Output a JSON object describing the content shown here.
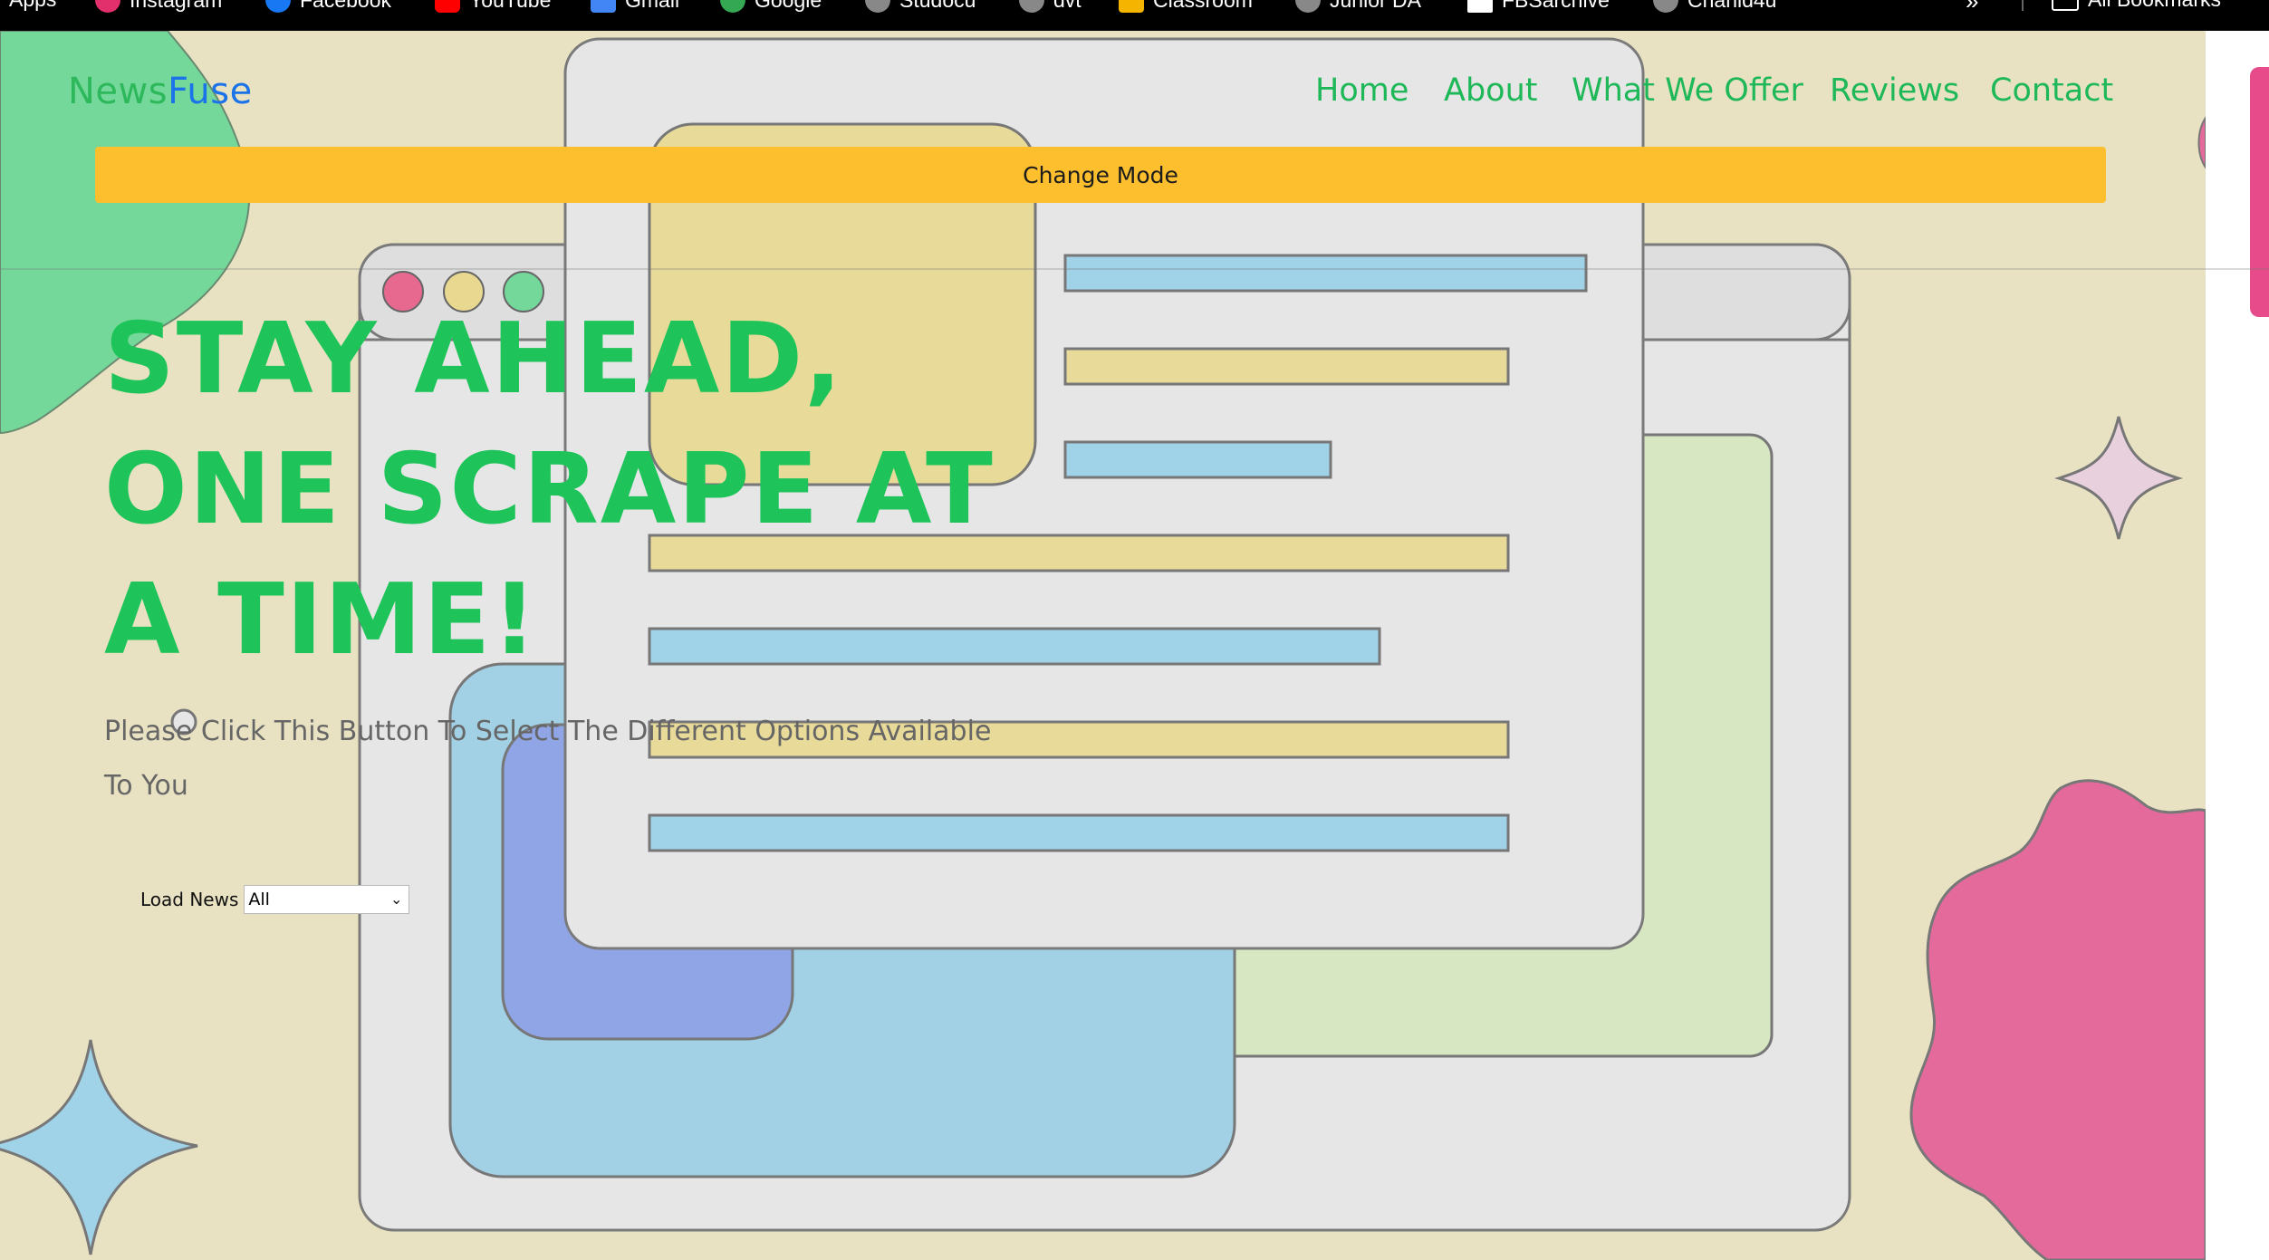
{
  "bookmarks": {
    "items": [
      {
        "label": "Apps",
        "icon": "apps-grid-icon",
        "color": "#ffffff"
      },
      {
        "label": "Instagram",
        "icon": "instagram-icon",
        "color": "#e1306c"
      },
      {
        "label": "Facebook",
        "icon": "facebook-icon",
        "color": "#1877f2"
      },
      {
        "label": "YouTube",
        "icon": "youtube-icon",
        "color": "#ff0000"
      },
      {
        "label": "Gmail",
        "icon": "gmail-icon",
        "color": "#4285f4"
      },
      {
        "label": "Google",
        "icon": "google-icon",
        "color": "#34a853"
      },
      {
        "label": "Studocu",
        "icon": "globe-icon",
        "color": "#888888"
      },
      {
        "label": "dvt",
        "icon": "globe-icon",
        "color": "#888888"
      },
      {
        "label": "Classroom",
        "icon": "classroom-icon",
        "color": "#f4b400"
      },
      {
        "label": "Junior DA",
        "icon": "globe-icon",
        "color": "#888888"
      },
      {
        "label": "FBSarchive",
        "icon": "page-icon",
        "color": "#ffffff"
      },
      {
        "label": "Chahid4u",
        "icon": "globe-icon",
        "color": "#888888"
      }
    ],
    "more": "»",
    "all_bookmarks": "All Bookmarks"
  },
  "site": {
    "logo_part1": "News",
    "logo_part2": "Fuse",
    "logo_colors": [
      "#2eb85c",
      "#1a73e8"
    ],
    "nav": [
      "Home",
      "About",
      "What We Offer",
      "Reviews",
      "Contact"
    ],
    "change_mode": "Change Mode"
  },
  "hero": {
    "title_line1": "STAY AHEAD,",
    "title_line2": "ONE SCRAPE AT",
    "title_line3": "A TIME!",
    "subtitle": "Please Click This Button To Select The Different Options Available To You"
  },
  "load_news": {
    "label": "Load News",
    "selected": "All"
  },
  "colors": {
    "background": "#e8e2c2",
    "accent_green": "#1ec459",
    "button_yellow": "#fdbf2d",
    "blob_pink": "#e46a9c",
    "blob_green": "#74d89a",
    "sparkle_blue": "#a0d2e8"
  }
}
